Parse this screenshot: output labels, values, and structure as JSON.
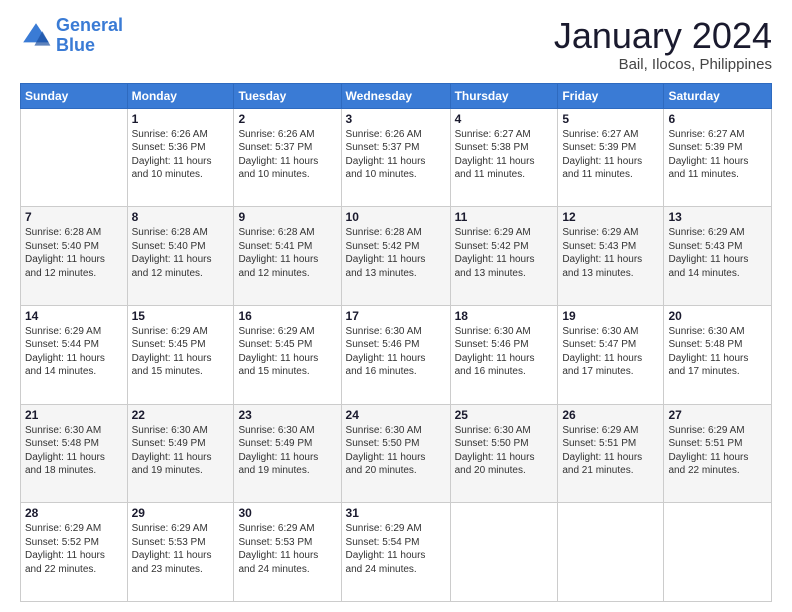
{
  "logo": {
    "line1": "General",
    "line2": "Blue"
  },
  "title": "January 2024",
  "subtitle": "Bail, Ilocos, Philippines",
  "days_of_week": [
    "Sunday",
    "Monday",
    "Tuesday",
    "Wednesday",
    "Thursday",
    "Friday",
    "Saturday"
  ],
  "weeks": [
    [
      {
        "day": "",
        "info": ""
      },
      {
        "day": "1",
        "info": "Sunrise: 6:26 AM\nSunset: 5:36 PM\nDaylight: 11 hours\nand 10 minutes."
      },
      {
        "day": "2",
        "info": "Sunrise: 6:26 AM\nSunset: 5:37 PM\nDaylight: 11 hours\nand 10 minutes."
      },
      {
        "day": "3",
        "info": "Sunrise: 6:26 AM\nSunset: 5:37 PM\nDaylight: 11 hours\nand 10 minutes."
      },
      {
        "day": "4",
        "info": "Sunrise: 6:27 AM\nSunset: 5:38 PM\nDaylight: 11 hours\nand 11 minutes."
      },
      {
        "day": "5",
        "info": "Sunrise: 6:27 AM\nSunset: 5:39 PM\nDaylight: 11 hours\nand 11 minutes."
      },
      {
        "day": "6",
        "info": "Sunrise: 6:27 AM\nSunset: 5:39 PM\nDaylight: 11 hours\nand 11 minutes."
      }
    ],
    [
      {
        "day": "7",
        "info": "Sunrise: 6:28 AM\nSunset: 5:40 PM\nDaylight: 11 hours\nand 12 minutes."
      },
      {
        "day": "8",
        "info": "Sunrise: 6:28 AM\nSunset: 5:40 PM\nDaylight: 11 hours\nand 12 minutes."
      },
      {
        "day": "9",
        "info": "Sunrise: 6:28 AM\nSunset: 5:41 PM\nDaylight: 11 hours\nand 12 minutes."
      },
      {
        "day": "10",
        "info": "Sunrise: 6:28 AM\nSunset: 5:42 PM\nDaylight: 11 hours\nand 13 minutes."
      },
      {
        "day": "11",
        "info": "Sunrise: 6:29 AM\nSunset: 5:42 PM\nDaylight: 11 hours\nand 13 minutes."
      },
      {
        "day": "12",
        "info": "Sunrise: 6:29 AM\nSunset: 5:43 PM\nDaylight: 11 hours\nand 13 minutes."
      },
      {
        "day": "13",
        "info": "Sunrise: 6:29 AM\nSunset: 5:43 PM\nDaylight: 11 hours\nand 14 minutes."
      }
    ],
    [
      {
        "day": "14",
        "info": "Sunrise: 6:29 AM\nSunset: 5:44 PM\nDaylight: 11 hours\nand 14 minutes."
      },
      {
        "day": "15",
        "info": "Sunrise: 6:29 AM\nSunset: 5:45 PM\nDaylight: 11 hours\nand 15 minutes."
      },
      {
        "day": "16",
        "info": "Sunrise: 6:29 AM\nSunset: 5:45 PM\nDaylight: 11 hours\nand 15 minutes."
      },
      {
        "day": "17",
        "info": "Sunrise: 6:30 AM\nSunset: 5:46 PM\nDaylight: 11 hours\nand 16 minutes."
      },
      {
        "day": "18",
        "info": "Sunrise: 6:30 AM\nSunset: 5:46 PM\nDaylight: 11 hours\nand 16 minutes."
      },
      {
        "day": "19",
        "info": "Sunrise: 6:30 AM\nSunset: 5:47 PM\nDaylight: 11 hours\nand 17 minutes."
      },
      {
        "day": "20",
        "info": "Sunrise: 6:30 AM\nSunset: 5:48 PM\nDaylight: 11 hours\nand 17 minutes."
      }
    ],
    [
      {
        "day": "21",
        "info": "Sunrise: 6:30 AM\nSunset: 5:48 PM\nDaylight: 11 hours\nand 18 minutes."
      },
      {
        "day": "22",
        "info": "Sunrise: 6:30 AM\nSunset: 5:49 PM\nDaylight: 11 hours\nand 19 minutes."
      },
      {
        "day": "23",
        "info": "Sunrise: 6:30 AM\nSunset: 5:49 PM\nDaylight: 11 hours\nand 19 minutes."
      },
      {
        "day": "24",
        "info": "Sunrise: 6:30 AM\nSunset: 5:50 PM\nDaylight: 11 hours\nand 20 minutes."
      },
      {
        "day": "25",
        "info": "Sunrise: 6:30 AM\nSunset: 5:50 PM\nDaylight: 11 hours\nand 20 minutes."
      },
      {
        "day": "26",
        "info": "Sunrise: 6:29 AM\nSunset: 5:51 PM\nDaylight: 11 hours\nand 21 minutes."
      },
      {
        "day": "27",
        "info": "Sunrise: 6:29 AM\nSunset: 5:51 PM\nDaylight: 11 hours\nand 22 minutes."
      }
    ],
    [
      {
        "day": "28",
        "info": "Sunrise: 6:29 AM\nSunset: 5:52 PM\nDaylight: 11 hours\nand 22 minutes."
      },
      {
        "day": "29",
        "info": "Sunrise: 6:29 AM\nSunset: 5:53 PM\nDaylight: 11 hours\nand 23 minutes."
      },
      {
        "day": "30",
        "info": "Sunrise: 6:29 AM\nSunset: 5:53 PM\nDaylight: 11 hours\nand 24 minutes."
      },
      {
        "day": "31",
        "info": "Sunrise: 6:29 AM\nSunset: 5:54 PM\nDaylight: 11 hours\nand 24 minutes."
      },
      {
        "day": "",
        "info": ""
      },
      {
        "day": "",
        "info": ""
      },
      {
        "day": "",
        "info": ""
      }
    ]
  ]
}
